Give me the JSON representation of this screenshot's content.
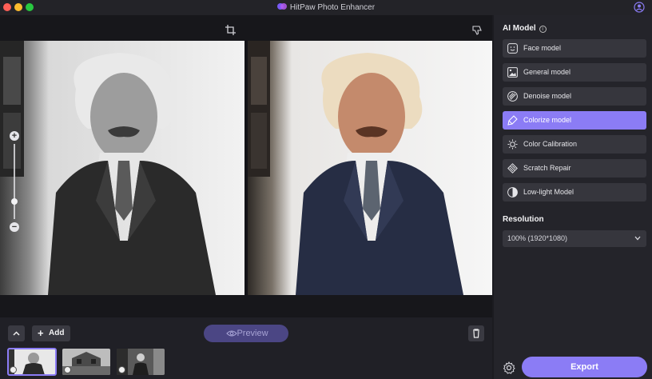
{
  "window": {
    "title": "HitPaw Photo Enhancer"
  },
  "toolbar": {
    "crop_icon": "crop-icon",
    "dislike_icon": "thumbs-down-icon"
  },
  "bottom_bar": {
    "add_label": "Add",
    "preview_label": "Preview",
    "thumbnails": [
      {
        "name": "portrait-bw",
        "active": true
      },
      {
        "name": "house-bw",
        "active": false
      },
      {
        "name": "group-bw",
        "active": false
      }
    ]
  },
  "panel": {
    "ai_model_title": "AI Model",
    "models": [
      {
        "label": "Face model",
        "icon": "face-icon",
        "active": false
      },
      {
        "label": "General model",
        "icon": "image-icon",
        "active": false
      },
      {
        "label": "Denoise model",
        "icon": "denoise-icon",
        "active": false
      },
      {
        "label": "Colorize model",
        "icon": "brush-icon",
        "active": true
      },
      {
        "label": "Color Calibration",
        "icon": "sun-icon",
        "active": false
      },
      {
        "label": "Scratch Repair",
        "icon": "scratch-icon",
        "active": false
      },
      {
        "label": "Low-light Model",
        "icon": "halfmoon-icon",
        "active": false
      }
    ],
    "resolution_title": "Resolution",
    "resolution_value": "100% (1920*1080)",
    "export_label": "Export"
  },
  "colors": {
    "accent": "#8b7cf5",
    "preview_disabled": "#4b4684",
    "panel_bg": "#24242a"
  }
}
